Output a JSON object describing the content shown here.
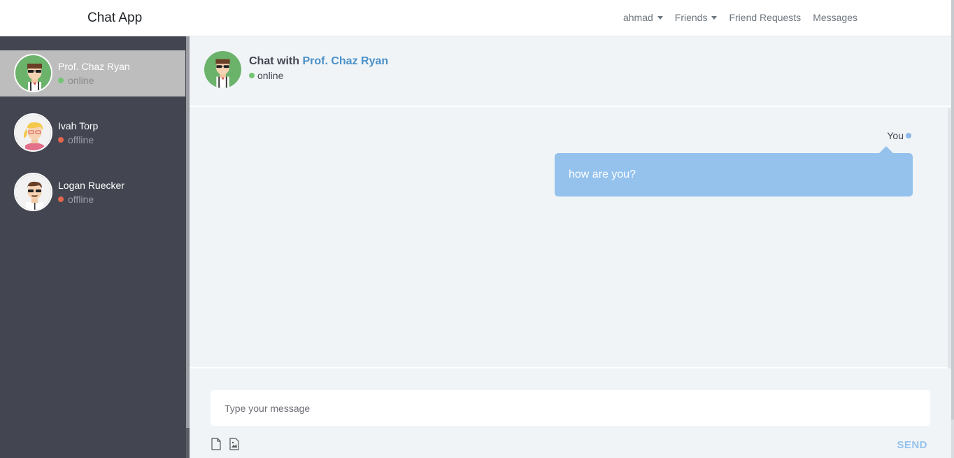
{
  "navbar": {
    "brand": "Chat App",
    "links": [
      {
        "label": "ahmad",
        "dropdown": true
      },
      {
        "label": "Friends",
        "dropdown": true
      },
      {
        "label": "Friend Requests",
        "dropdown": false
      },
      {
        "label": "Messages",
        "dropdown": false
      }
    ]
  },
  "contacts": [
    {
      "name": "Prof. Chaz Ryan",
      "status": "online",
      "active": true,
      "avatar": "avatar-sunglasses-green"
    },
    {
      "name": "Ivah Torp",
      "status": "offline",
      "active": false,
      "avatar": "avatar-blonde-woman"
    },
    {
      "name": "Logan Ruecker",
      "status": "offline",
      "active": false,
      "avatar": "avatar-sunglasses-white"
    }
  ],
  "chat": {
    "title_prefix": "Chat with",
    "title_name": "Prof. Chaz Ryan",
    "status": "online"
  },
  "messages": [
    {
      "sender": "You",
      "text": "how are you?"
    }
  ],
  "composer": {
    "placeholder": "Type your message",
    "send_label": "SEND",
    "icons": [
      "file-icon",
      "image-icon"
    ]
  },
  "colors": {
    "sidebar_bg": "#434651",
    "chat_bg": "#f0f4f7",
    "accent": "#4a90c9",
    "bubble": "#94c2ed",
    "online": "#74c574",
    "offline": "#e5664e"
  }
}
